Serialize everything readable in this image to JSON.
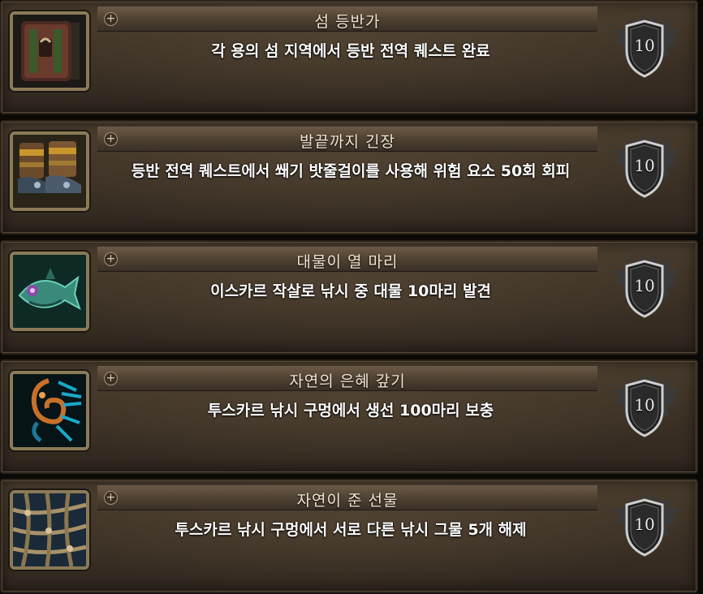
{
  "achievements": [
    {
      "title": "섬 등반가",
      "description": "각 용의 섬 지역에서 등반 전역 퀘스트 완료",
      "points": "10",
      "icon": "chest-icon"
    },
    {
      "title": "발끝까지 긴장",
      "description": "등반 전역 퀘스트에서 쐐기 밧줄걸이를 사용해 위험 요소 50회 회피",
      "points": "10",
      "icon": "boots-icon"
    },
    {
      "title": "대물이 열 마리",
      "description": "이스카르 작살로 낚시 중 대물 10마리 발견",
      "points": "10",
      "icon": "fish-icon"
    },
    {
      "title": "자연의 은혜 갚기",
      "description": "투스카르 낚시 구멍에서 생선 100마리 보충",
      "points": "10",
      "icon": "swirl-icon"
    },
    {
      "title": "자연이 준 선물",
      "description": "투스카르 낚시 구멍에서 서로 다른 낚시 그물 5개 해제",
      "points": "10",
      "icon": "net-icon"
    }
  ],
  "expand_symbol": "+",
  "colors": {
    "row_bg": "#3d3226",
    "title_text": "#f2e6d2",
    "desc_text": "#ffffff",
    "frame_gold": "#8a7a58"
  }
}
